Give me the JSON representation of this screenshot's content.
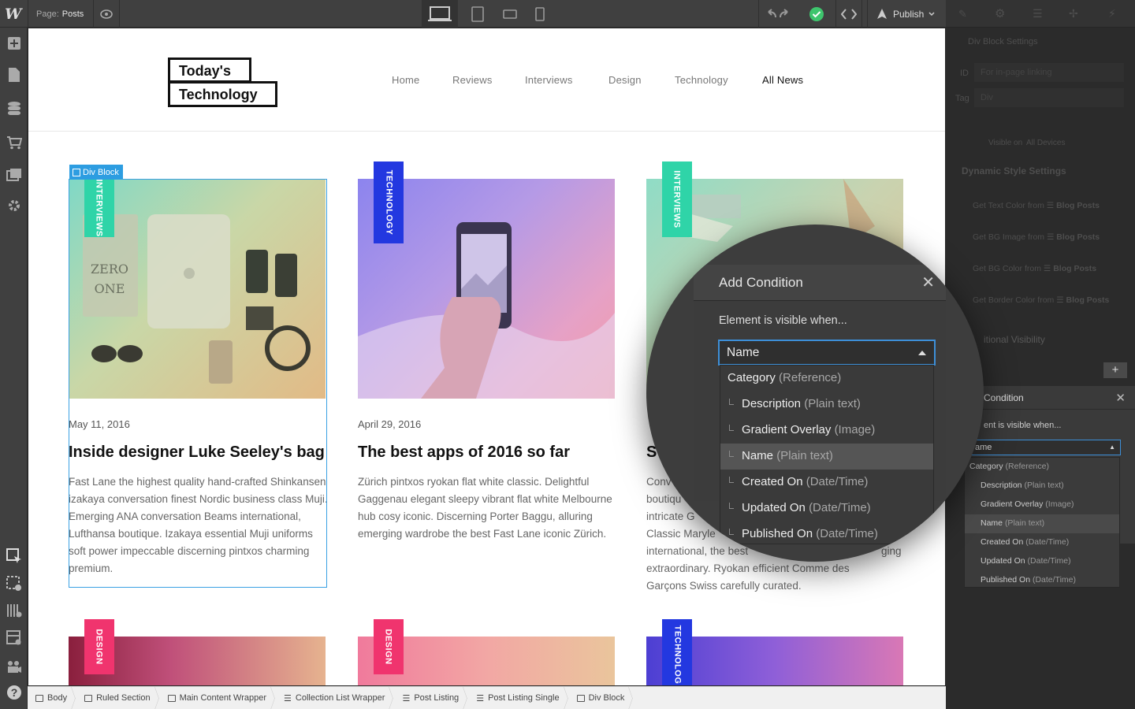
{
  "topbar": {
    "logo": "W",
    "page_label": "Page:",
    "page_name": "Posts",
    "publish_label": "Publish"
  },
  "site": {
    "brand_line1": "Today's",
    "brand_line2": "Technology",
    "nav": [
      "Home",
      "Reviews",
      "Interviews",
      "Design",
      "Technology",
      "All News"
    ]
  },
  "selection": {
    "label": "Div Block"
  },
  "posts": [
    {
      "tag": "INTERVIEWS",
      "tag_color": "#2fd4a8",
      "date": "May 11, 2016",
      "title": "Inside designer Luke Seeley's bag",
      "desc": "Fast Lane the highest quality hand-crafted Shinkansen izakaya conversation finest Nordic business class Muji. Emerging ANA conversation Beams international, Lufthansa boutique. Izakaya essential Muji uniforms soft power impeccable discerning pintxos charming premium."
    },
    {
      "tag": "TECHNOLOGY",
      "tag_color": "#2338e0",
      "date": "April 29, 2016",
      "title": "The best apps of 2016 so far",
      "desc": "Zürich pintxos ryokan flat white classic. Delightful Gaggenau elegant sleepy vibrant flat white Melbourne hub cosy iconic. Discerning Porter Baggu, alluring emerging wardrobe the best Fast Lane iconic Zürich."
    },
    {
      "tag": "INTERVIEWS",
      "tag_color": "#2fd4a8",
      "date": "",
      "title": "S",
      "desc_lines": [
        "Conv",
        "boutiqu",
        "intricate G",
        "Classic Maryle",
        "international, the best",
        "extraordinary. Ryokan efficient Comme des",
        "Garçons Swiss carefully curated."
      ],
      "desc_right": "ging"
    }
  ],
  "bottom_tags": [
    {
      "tag": "DESIGN",
      "color": "#f0346e"
    },
    {
      "tag": "DESIGN",
      "color": "#f0346e"
    },
    {
      "tag": "TECHNOLOG",
      "color": "#2338e0"
    }
  ],
  "breadcrumbs": [
    "Body",
    "Ruled Section",
    "Main Content Wrapper",
    "Collection List Wrapper",
    "Post Listing",
    "Post Listing Single",
    "Div Block"
  ],
  "right_panel": {
    "div_block_settings": "Div Block Settings",
    "id_label": "ID",
    "id_placeholder": "For in-page linking",
    "tag_label": "Tag",
    "tag_value": "Div",
    "visibility_label": "Visible on",
    "visibility_all": "All Devices",
    "dynamic_style_settings": "Dynamic Style Settings",
    "dynamic_items": [
      {
        "label": "Get Text Color from",
        "source": "Blog Posts"
      },
      {
        "label": "Get BG Image from",
        "source": "Blog Posts"
      },
      {
        "label": "Get BG Color from",
        "source": "Blog Posts"
      },
      {
        "label": "Get Border Color from",
        "source": "Blog Posts"
      }
    ],
    "conditional_visibility": "itional Visibility",
    "small_dialog_title": "Condition",
    "small_visible_when": "ent is visible when...",
    "small_select_value": "ame"
  },
  "condition_dialog": {
    "title": "Add Condition",
    "visible_when": "Element is visible when...",
    "selected": "Name",
    "options": [
      {
        "name": "Category",
        "type": "(Reference)",
        "nested": false
      },
      {
        "name": "Description",
        "type": "(Plain text)",
        "nested": true
      },
      {
        "name": "Gradient Overlay",
        "type": "(Image)",
        "nested": true
      },
      {
        "name": "Name",
        "type": "(Plain text)",
        "nested": true,
        "selected": true
      },
      {
        "name": "Created On",
        "type": "(Date/Time)",
        "nested": true
      },
      {
        "name": "Updated On",
        "type": "(Date/Time)",
        "nested": true
      },
      {
        "name": "Published On",
        "type": "(Date/Time)",
        "nested": true
      }
    ]
  }
}
